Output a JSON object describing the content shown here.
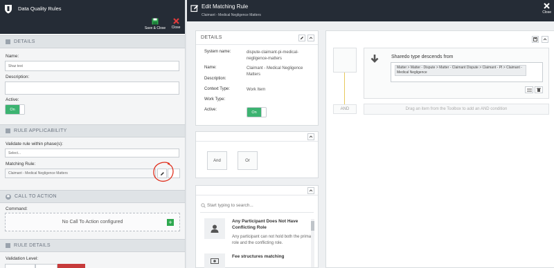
{
  "left_panel": {
    "title": "Data Quality Rules",
    "save_close_label": "Save & Close",
    "close_label": "Close",
    "details": {
      "heading": "DETAILS",
      "name_label": "Name:",
      "name_value": "Shaz test",
      "description_label": "Description:",
      "description_value": "",
      "active_label": "Active:",
      "active_value": "On"
    },
    "rule_applicability": {
      "heading": "RULE APPLICABILITY",
      "phase_label": "Validate rule within phase(s):",
      "phase_value": "Select...",
      "matching_rule_label": "Matching Rule:",
      "matching_rule_value": "Claimant - Medical Negligence Matters"
    },
    "call_to_action": {
      "heading": "CALL TO ACTION",
      "command_label": "Command:",
      "empty_text": "No Call To Action configured"
    },
    "rule_details": {
      "heading": "RULE DETAILS",
      "validation_level_label": "Validation Level:"
    }
  },
  "modal": {
    "title": "Edit Matching Rule",
    "subtitle": "Claimant - Medical Negligence Matters",
    "close_label": "Close",
    "details": {
      "heading": "DETAILS",
      "rows": [
        {
          "key": "System name:",
          "value": "dispute-claimant-pi-medical-negligence-matters"
        },
        {
          "key": "Name:",
          "value": "Claimant - Medical Negligence Matters"
        },
        {
          "key": "Description:",
          "value": ""
        },
        {
          "key": "Context Type:",
          "value": "Work Item"
        },
        {
          "key": "Work Type:",
          "value": ""
        },
        {
          "key": "Active:",
          "value": ""
        }
      ],
      "active_value": "On"
    },
    "operators": {
      "and_label": "And",
      "or_label": "Or"
    },
    "toolbox": {
      "search_placeholder": "Start typing to search...",
      "items": [
        {
          "title": "Any Participant Does Not Have Conflicting Role",
          "description": "Any participant can not hold both the primary role and the conflicting role."
        },
        {
          "title": "Fee structures matching",
          "description": ""
        }
      ]
    },
    "condition": {
      "title": "Sharedo type descends from",
      "path_value": "Matter > Matter - Dispute > Matter - Claimant Dispute > Claimant - PI > Claimant - Medical Negligence",
      "and_label": "AND",
      "drop_hint": "Drag an item from the Toolbox to add an AND condition"
    }
  },
  "colors": {
    "header_bg": "#252c36",
    "toggle_on": "#3cb371",
    "close_red": "#e03b3b",
    "add_green": "#2ea84f",
    "annotation_red": "#e0301e"
  }
}
